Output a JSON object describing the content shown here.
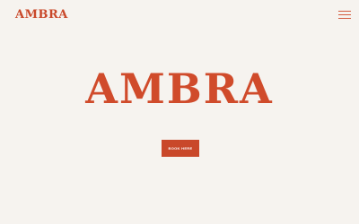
{
  "brand": {
    "logo_text": "AMBRA",
    "accent_color": "#c9482a",
    "background_color": "#f6f3ef"
  },
  "header": {
    "menu_icon": "hamburger-menu-icon"
  },
  "hero": {
    "title": "AMBRA",
    "cta_label": "BOOK HERE"
  }
}
